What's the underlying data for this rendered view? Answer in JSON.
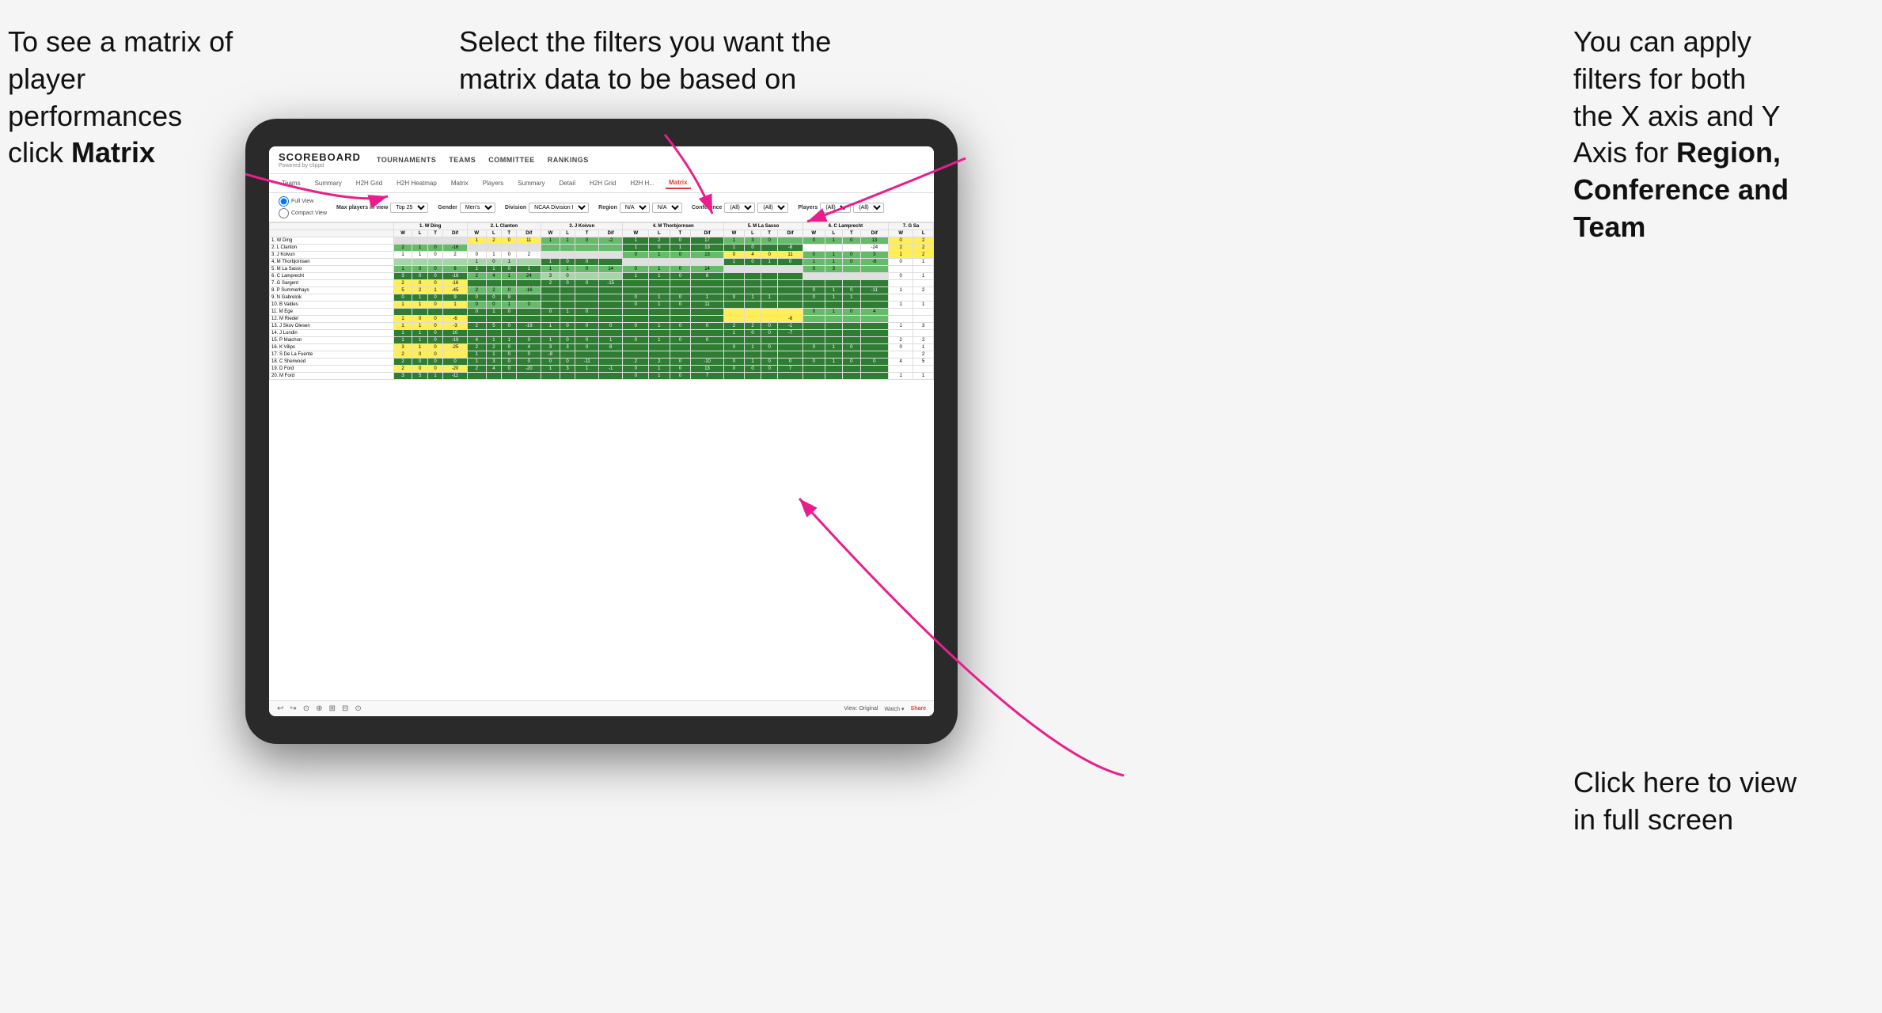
{
  "annotations": {
    "left": {
      "line1": "To see a matrix of",
      "line2": "player performances",
      "line3_normal": "click ",
      "line3_bold": "Matrix"
    },
    "center": {
      "text": "Select the filters you want the matrix data to be based on"
    },
    "right": {
      "line1": "You  can apply",
      "line2": "filters for both",
      "line3": "the X axis and Y",
      "line4_normal": "Axis for ",
      "line4_bold": "Region,",
      "line5_bold": "Conference and",
      "line6_bold": "Team"
    },
    "bottom_right": {
      "line1": "Click here to view",
      "line2": "in full screen"
    }
  },
  "scoreboard": {
    "logo": "SCOREBOARD",
    "logo_sub": "Powered by clippd",
    "nav": [
      "TOURNAMENTS",
      "TEAMS",
      "COMMITTEE",
      "RANKINGS"
    ]
  },
  "sub_nav": {
    "items": [
      "Teams",
      "Summary",
      "H2H Grid",
      "H2H Heatmap",
      "Matrix",
      "Players",
      "Summary",
      "Detail",
      "H2H Grid",
      "H2H H...",
      "Matrix"
    ],
    "active": "Matrix"
  },
  "filters": {
    "view_options": [
      "Full View",
      "Compact View"
    ],
    "max_players": {
      "label": "Max players in view",
      "value": "Top 25"
    },
    "gender": {
      "label": "Gender",
      "value": "Men's"
    },
    "division": {
      "label": "Division",
      "value": "NCAA Division I"
    },
    "region": {
      "label": "Region",
      "values": [
        "N/A",
        "N/A"
      ]
    },
    "conference": {
      "label": "Conference",
      "values": [
        "(All)",
        "(All)"
      ]
    },
    "players": {
      "label": "Players",
      "values": [
        "(All)",
        "(All)"
      ]
    }
  },
  "matrix": {
    "col_headers": [
      "1. W Ding",
      "2. L Clanton",
      "3. J Koivun",
      "4. M Thorbjornsen",
      "5. M La Sasso",
      "6. C Lamprecht",
      "7. G Sa"
    ],
    "sub_headers": [
      "W",
      "L",
      "T",
      "Dif"
    ],
    "rows": [
      {
        "name": "1. W Ding",
        "cells": []
      },
      {
        "name": "2. L Clanton",
        "cells": []
      },
      {
        "name": "3. J Koivun",
        "cells": []
      },
      {
        "name": "4. M Thorbjornsen",
        "cells": []
      },
      {
        "name": "5. M La Sasso",
        "cells": []
      },
      {
        "name": "6. C Lamprecht",
        "cells": []
      },
      {
        "name": "7. G Sargent",
        "cells": []
      },
      {
        "name": "8. P Summerhays",
        "cells": []
      },
      {
        "name": "9. N Gabrelcik",
        "cells": []
      },
      {
        "name": "10. B Valdes",
        "cells": []
      },
      {
        "name": "11. M Ege",
        "cells": []
      },
      {
        "name": "12. M Riedel",
        "cells": []
      },
      {
        "name": "13. J Skov Olesen",
        "cells": []
      },
      {
        "name": "14. J Lundin",
        "cells": []
      },
      {
        "name": "15. P Maichon",
        "cells": []
      },
      {
        "name": "16. K Vilips",
        "cells": []
      },
      {
        "name": "17. S De La Fuente",
        "cells": []
      },
      {
        "name": "18. C Sherwood",
        "cells": []
      },
      {
        "name": "19. D Ford",
        "cells": []
      },
      {
        "name": "20. M Ford",
        "cells": []
      }
    ]
  },
  "toolbar": {
    "left_icons": [
      "↩",
      "↪",
      "⊙",
      "⊕",
      "⊞",
      "⊟",
      "⊙"
    ],
    "view_original": "View: Original",
    "watch": "Watch ▾",
    "share": "Share"
  }
}
